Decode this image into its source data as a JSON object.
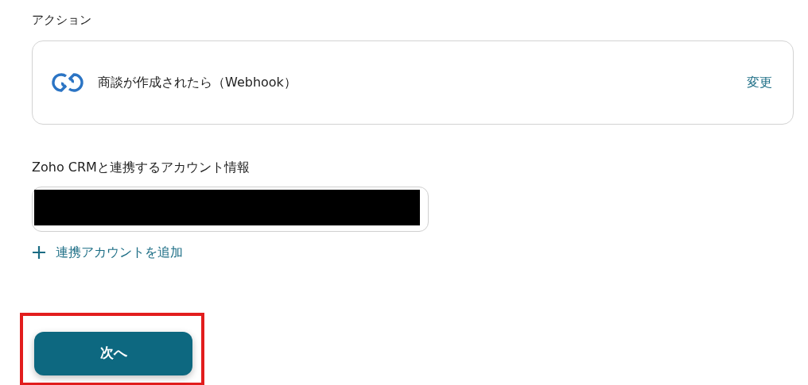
{
  "section_label": "アクション",
  "action": {
    "title": "商談が作成されたら（Webhook）",
    "change_link": "変更"
  },
  "account": {
    "label": "Zoho CRMと連携するアカウント情報",
    "redacted": true,
    "add_link": "連携アカウントを追加"
  },
  "next_button": {
    "label": "次へ",
    "highlighted": true
  }
}
